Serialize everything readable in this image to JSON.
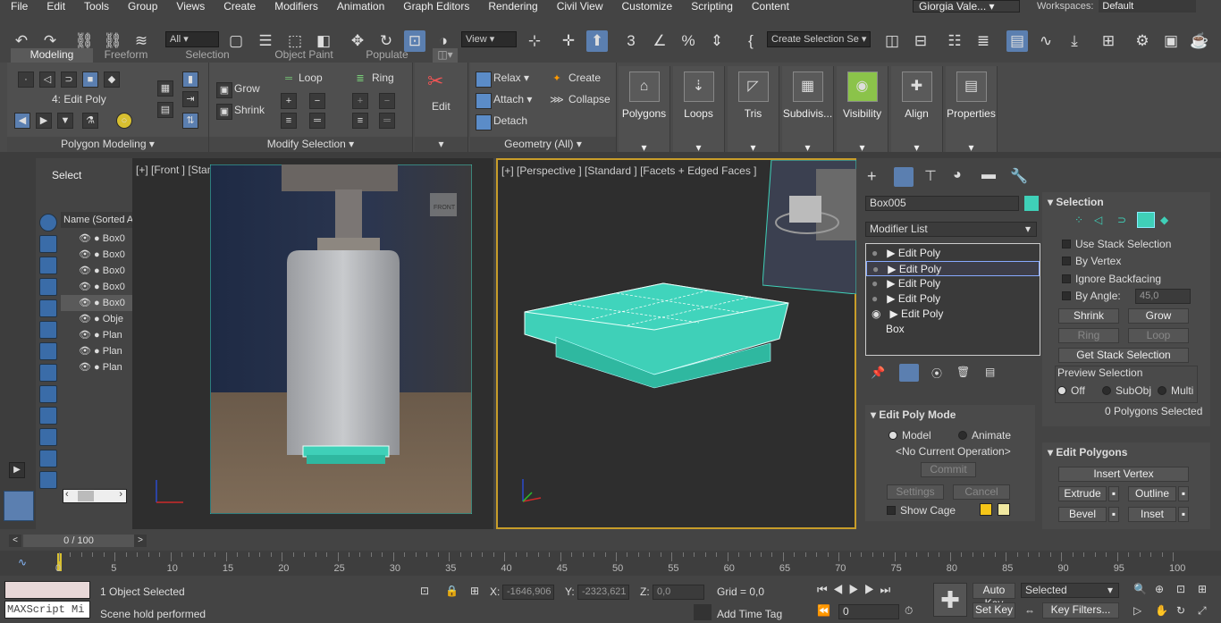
{
  "menu": [
    "File",
    "Edit",
    "Tools",
    "Group",
    "Views",
    "Create",
    "Modifiers",
    "Animation",
    "Graph Editors",
    "Rendering",
    "Civil View",
    "Customize",
    "Scripting",
    "Content"
  ],
  "user": "Giorgia Vale...",
  "workspaces_label": "Workspaces:",
  "workspace": "Default",
  "toolbar": {
    "filter": "All",
    "refcoord": "View",
    "selection_set": "Create Selection Se"
  },
  "ribbon_tabs": [
    "Modeling",
    "Freeform",
    "Selection",
    "Object Paint",
    "Populate"
  ],
  "ribbon": {
    "edit_poly_label": "4: Edit Poly",
    "polygon_modeling": "Polygon Modeling",
    "grow": "Grow",
    "shrink": "Shrink",
    "loop": "Loop",
    "ring": "Ring",
    "modify_selection": "Modify Selection",
    "edit": "Edit",
    "relax": "Relax",
    "attach": "Attach",
    "detach": "Detach",
    "create": "Create",
    "collapse": "Collapse",
    "geometry_all": "Geometry (All)",
    "big_buttons": [
      "Polygons",
      "Loops",
      "Tris",
      "Subdivis...",
      "Visibility",
      "Align",
      "Properties"
    ]
  },
  "scene_explorer": {
    "title": "Select",
    "name_header": "Name (Sorted A",
    "items": [
      "Box0",
      "Box0",
      "Box0",
      "Box0",
      "Box0",
      "Obje",
      "Plan",
      "Plan",
      "Plan"
    ]
  },
  "viewports": {
    "front": "[+] [Front ] [Standard ] [Facets + Edged Faces ]",
    "persp": "[+] [Perspective ] [Standard ] [Facets + Edged Faces ]",
    "front_cube": "FRONT"
  },
  "command_panel": {
    "object_name": "Box005",
    "modifier_list": "Modifier List",
    "stack": [
      "Edit Poly",
      "Edit Poly",
      "Edit Poly",
      "Edit Poly",
      "Edit Poly",
      "Box"
    ],
    "edit_poly_mode": "Edit Poly Mode",
    "model": "Model",
    "animate": "Animate",
    "no_op": "<No Current Operation>",
    "commit": "Commit",
    "settings": "Settings",
    "cancel": "Cancel",
    "show_cage": "Show Cage",
    "selection": "Selection",
    "use_stack": "Use Stack Selection",
    "by_vertex": "By Vertex",
    "ignore_backfacing": "Ignore Backfacing",
    "by_angle": "By Angle:",
    "angle_val": "45,0",
    "shrink": "Shrink",
    "grow": "Grow",
    "ring": "Ring",
    "loop": "Loop",
    "get_stack": "Get Stack Selection",
    "preview": "Preview Selection",
    "off": "Off",
    "subobj": "SubObj",
    "multi": "Multi",
    "polys_selected": "0 Polygons Selected",
    "edit_polygons": "Edit Polygons",
    "insert_vertex": "Insert Vertex",
    "extrude": "Extrude",
    "outline": "Outline",
    "bevel": "Bevel",
    "inset": "Inset",
    "swatch1": "#f5c518",
    "swatch2": "#f0e8a0"
  },
  "timeline": {
    "frame": "0 / 100",
    "ticks": [
      "0",
      "5",
      "10",
      "15",
      "20",
      "25",
      "30",
      "35",
      "40",
      "45",
      "50",
      "55",
      "60",
      "65",
      "70",
      "75",
      "80",
      "85",
      "90",
      "95",
      "100"
    ]
  },
  "status": {
    "maxscript": "MAXScript Mi",
    "selected": "1 Object Selected",
    "prompt": "Scene hold performed",
    "x_label": "X:",
    "x_val": "-1646,906",
    "y_label": "Y:",
    "y_val": "-2323,621",
    "z_label": "Z:",
    "z_val": "0,0",
    "grid": "Grid = 0,0",
    "add_time_tag": "Add Time Tag",
    "auto_key": "Auto Key",
    "selected_dd": "Selected",
    "set_key": "Set Key",
    "key_filters": "Key Filters...",
    "frame_val": "0"
  },
  "colors": {
    "accent": "#5b7fb0",
    "cyan_mesh": "#3fd0b8",
    "active_border": "#c89d2a"
  }
}
